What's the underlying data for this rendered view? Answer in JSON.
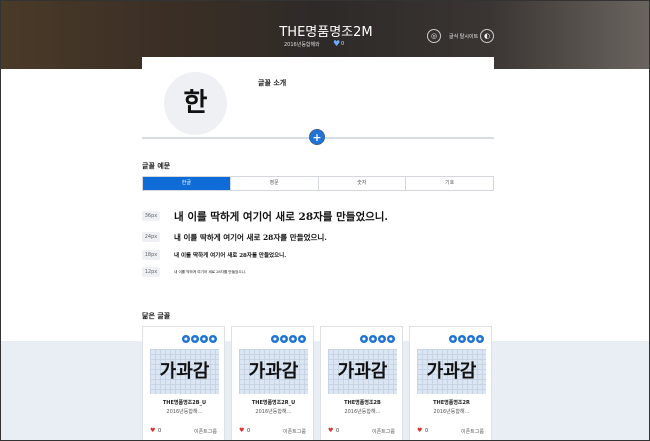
{
  "hero": {
    "title": "THE명품명조2M",
    "subtitle": "2016년등합해와",
    "like_count": "0",
    "buttons": [
      {
        "icon": "chat-icon",
        "glyph": "◎"
      },
      {
        "label": "글식 탈시이트",
        "icon": "globe-icon",
        "glyph": "◐"
      }
    ]
  },
  "intro": {
    "glyph": "한",
    "label": "글꼴 소개",
    "expand_glyph": "+"
  },
  "samples": {
    "title": "글꼴 예문",
    "tabs": [
      "한글",
      "영문",
      "숫자",
      "기호"
    ],
    "active_tab": 0,
    "rows": [
      {
        "size": "36px",
        "text": "내 이를 딱하게 여기어 새로 28자를 만들었으니."
      },
      {
        "size": "24px",
        "text": "내 이를 딱하게 여기어 새로 28자를 만들었으니."
      },
      {
        "size": "18px",
        "text": "내 이를 딱하게 여기어 새로 28자를 만들었으니."
      },
      {
        "size": "12px",
        "text": "내 이를 딱하게 여기어 새로 28자를 만들었으니."
      }
    ]
  },
  "similar": {
    "title": "닮은 글꼴",
    "cards": [
      {
        "glyph": "가과감",
        "name": "THE명품명조2B_U",
        "maker": "2016년등합해…",
        "count": "0",
        "owner": "이픈트그룹"
      },
      {
        "glyph": "가과감",
        "name": "THE명품명조2R_U",
        "maker": "2016년등합해…",
        "count": "0",
        "owner": "이픈트그룹"
      },
      {
        "glyph": "가과감",
        "name": "THE명품명조2B",
        "maker": "2016년등합해…",
        "count": "0",
        "owner": "이픈트그룹"
      },
      {
        "glyph": "가과감",
        "name": "THE명품명조2R",
        "maker": "2016년등합해…",
        "count": "0",
        "owner": "이픈트그룹"
      }
    ]
  },
  "colors": {
    "accent": "#0f6cd6",
    "heart": "#e03030",
    "similar_bg": "#e9eef5"
  }
}
